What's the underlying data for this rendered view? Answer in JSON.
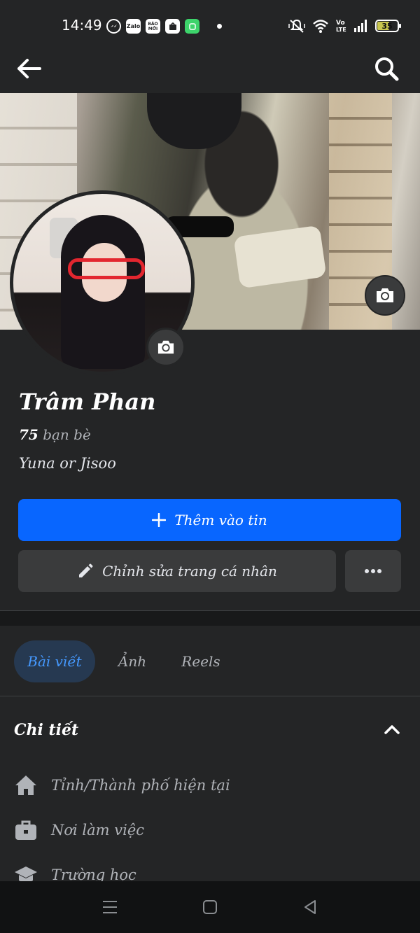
{
  "status_bar": {
    "time": "14:49",
    "notification_icons": [
      "messenger-icon",
      "zalo-icon",
      "baomoi-icon",
      "shopee-icon",
      "app-icon"
    ],
    "zalo_label": "Zalo",
    "baomoi_label": "BÁO MỚI",
    "battery": "35"
  },
  "profile": {
    "name": "Trâm Phan",
    "friends_count": "75",
    "friends_label": "bạn bè",
    "bio": "Yuna or Jisoo"
  },
  "actions": {
    "add_story_label": "Thêm vào tin",
    "edit_profile_label": "Chỉnh sửa trang cá nhân"
  },
  "tabs": [
    {
      "label": "Bài viết",
      "active": true
    },
    {
      "label": "Ảnh",
      "active": false
    },
    {
      "label": "Reels",
      "active": false
    }
  ],
  "details": {
    "heading": "Chi tiết",
    "items": [
      {
        "icon": "home-icon",
        "label": "Tỉnh/Thành phố hiện tại"
      },
      {
        "icon": "briefcase-icon",
        "label": "Nơi làm việc"
      },
      {
        "icon": "graduation-cap-icon",
        "label": "Trường học"
      }
    ]
  },
  "colors": {
    "background": "#242526",
    "primary_button": "#0866ff",
    "secondary_button": "#3a3b3c",
    "active_tab_bg": "#263951",
    "active_tab_text": "#4599ff"
  }
}
